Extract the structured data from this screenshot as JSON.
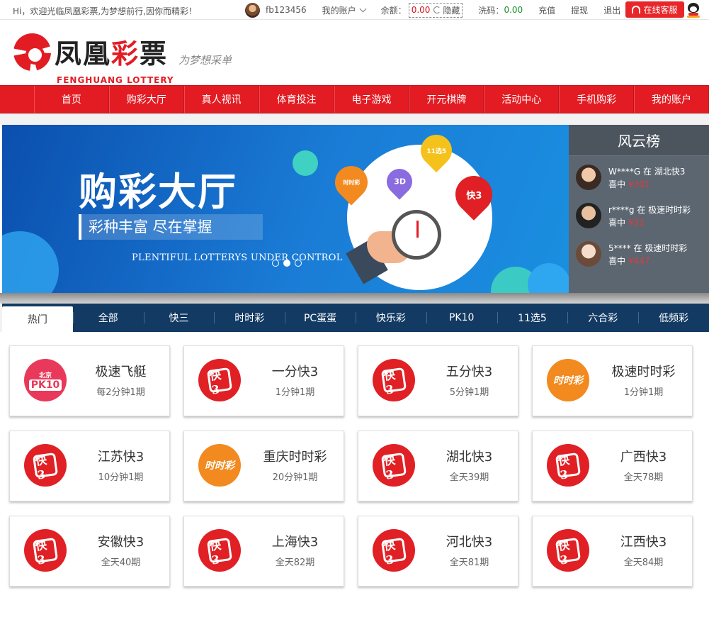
{
  "topbar": {
    "welcome": "Hi，欢迎光临凤凰彩票,为梦想前行,因你而精彩！",
    "username": "fb123456",
    "account_menu": "我的账户",
    "balance_label": "余额：",
    "balance_value": "0.00",
    "hide_label": "隐藏",
    "xima_label": "洗码：",
    "xima_value": "0.00",
    "recharge": "充值",
    "withdraw": "提现",
    "logout": "退出",
    "customer_service": "在线客服"
  },
  "header": {
    "logo_cn_1": "凤凰",
    "logo_cn_2": "彩",
    "logo_cn_3": "票",
    "logo_en": "FENGHUANG LOTTERY",
    "slogan": "为梦想采单"
  },
  "nav": {
    "items": [
      "首页",
      "购彩大厅",
      "真人视讯",
      "体育投注",
      "电子游戏",
      "开元棋牌",
      "活动中心",
      "手机购彩",
      "我的账户"
    ]
  },
  "banner": {
    "title": "购彩大厅",
    "subtitle": "彩种丰富 尽在掌握",
    "english": "PLENTIFUL LOTTERYS UNDER CONTROL",
    "pins": [
      "时时彩",
      "3D",
      "11选5",
      "快3"
    ]
  },
  "rank": {
    "title": "风云榜",
    "items": [
      {
        "line1": "W****G 在 湖北快3",
        "won": "喜中",
        "amount": "¥301"
      },
      {
        "line1": "r****g 在 极速时时彩",
        "won": "喜中",
        "amount": "¥32"
      },
      {
        "line1": "5**** 在 极速时时彩",
        "won": "喜中",
        "amount": "¥447"
      }
    ]
  },
  "tabs": [
    "热门",
    "全部",
    "快三",
    "时时彩",
    "PC蛋蛋",
    "快乐彩",
    "PK10",
    "11选5",
    "六合彩",
    "低频彩"
  ],
  "games": [
    {
      "name": "极速飞艇",
      "period": "每2分钟1期",
      "icon": "pk10-icon",
      "icon_text_top": "北京",
      "icon_text": "PK10"
    },
    {
      "name": "一分快3",
      "period": "1分钟1期",
      "icon": "kuai3-icon",
      "icon_text": "快3"
    },
    {
      "name": "五分快3",
      "period": "5分钟1期",
      "icon": "kuai3-icon",
      "icon_text": "快3"
    },
    {
      "name": "极速时时彩",
      "period": "1分钟1期",
      "icon": "ssc-icon",
      "icon_text": "时时彩"
    },
    {
      "name": "江苏快3",
      "period": "10分钟1期",
      "icon": "kuai3-icon",
      "icon_text": "快3"
    },
    {
      "name": "重庆时时彩",
      "period": "20分钟1期",
      "icon": "ssc-icon",
      "icon_text": "时时彩"
    },
    {
      "name": "湖北快3",
      "period": "全天39期",
      "icon": "kuai3-icon",
      "icon_text": "快3"
    },
    {
      "name": "广西快3",
      "period": "全天78期",
      "icon": "kuai3-icon",
      "icon_text": "快3"
    },
    {
      "name": "安徽快3",
      "period": "全天40期",
      "icon": "kuai3-icon",
      "icon_text": "快3"
    },
    {
      "name": "上海快3",
      "period": "全天82期",
      "icon": "kuai3-icon",
      "icon_text": "快3"
    },
    {
      "name": "河北快3",
      "period": "全天81期",
      "icon": "kuai3-icon",
      "icon_text": "快3"
    },
    {
      "name": "江西快3",
      "period": "全天84期",
      "icon": "kuai3-icon",
      "icon_text": "快3"
    }
  ],
  "colors": {
    "brand_red": "#e31c23",
    "tab_navy": "#123a63",
    "rank_grey": "#5c6670"
  }
}
